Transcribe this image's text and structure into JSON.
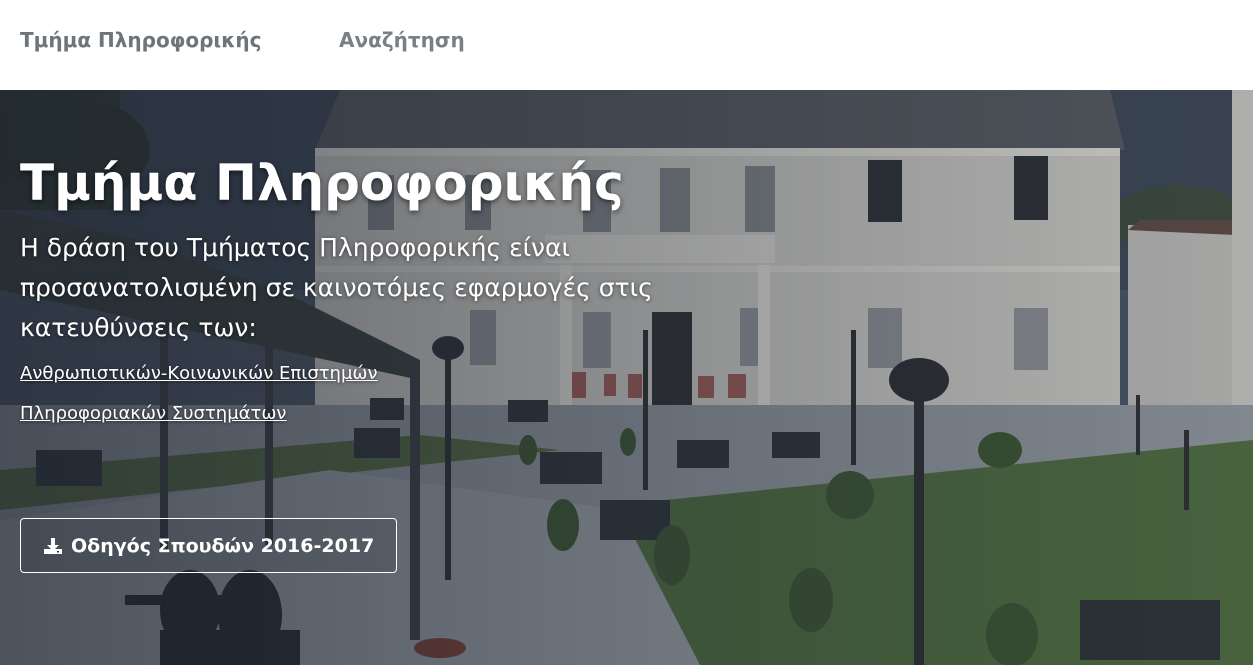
{
  "navbar": {
    "brand": "Τμήμα Πληροφορικής",
    "search_link": "Αναζήτηση"
  },
  "hero": {
    "title": "Τμήμα Πληροφορικής",
    "lead": "Η δράση του Τμήματος Πληροφορικής είναι προσανατολισμένη σε καινοτόμες εφαρμογές στις κατευθύνσεις των:",
    "links": [
      "Ανθρωπιστικών-Κοινωνικών Επιστημών",
      "Πληροφοριακών Συστημάτων"
    ],
    "download_button": "Οδηγός Σπουδών 2016-2017",
    "download_icon": "download-icon",
    "photo_subject": "university-building-courtyard"
  },
  "colors": {
    "nav_text": "#6f737a",
    "hero_text": "#ffffff",
    "overlay": "#1e2430"
  }
}
